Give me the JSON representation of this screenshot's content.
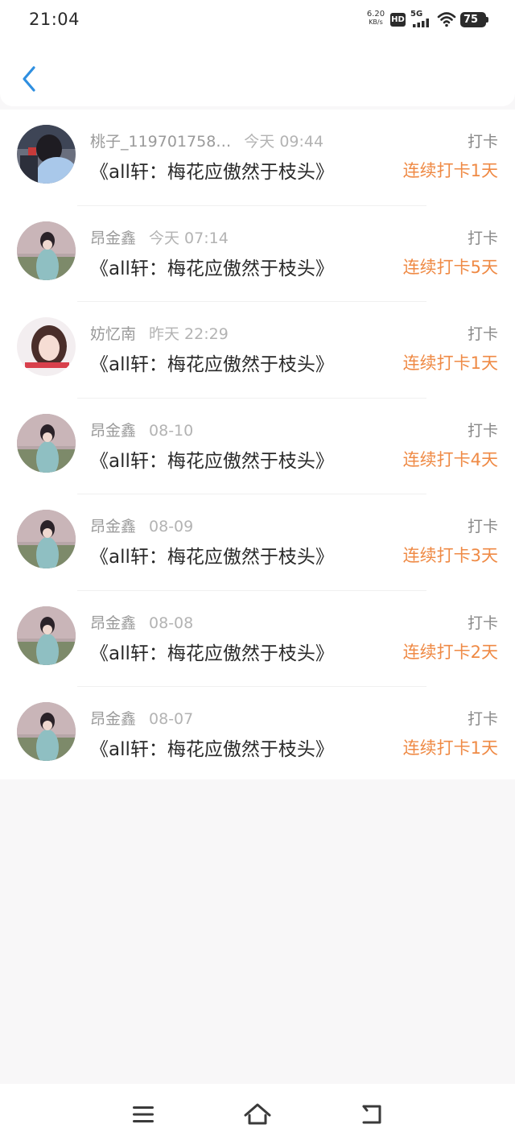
{
  "status_bar": {
    "time": "21:04",
    "net_speed_value": "6.20",
    "net_speed_unit": "KB/s",
    "hd": "HD",
    "network": "5G",
    "battery": "75"
  },
  "header": {
    "back_icon": "chevron-left-icon",
    "accent_color": "#2f8fe0"
  },
  "checkins": [
    {
      "user": "桃子_119701758…",
      "time": "今天 09:44",
      "title": "《all轩：梅花应傲然于枝头》",
      "type": "打卡",
      "streak": "连续打卡1天",
      "avatar": "avatar-photo-1"
    },
    {
      "user": "昂金鑫",
      "time": "今天 07:14",
      "title": "《all轩：梅花应傲然于枝头》",
      "type": "打卡",
      "streak": "连续打卡5天",
      "avatar": "avatar-photo-2"
    },
    {
      "user": "妨忆南",
      "time": "昨天 22:29",
      "title": "《all轩：梅花应傲然于枝头》",
      "type": "打卡",
      "streak": "连续打卡1天",
      "avatar": "avatar-photo-3"
    },
    {
      "user": "昂金鑫",
      "time": "08-10",
      "title": "《all轩：梅花应傲然于枝头》",
      "type": "打卡",
      "streak": "连续打卡4天",
      "avatar": "avatar-photo-2"
    },
    {
      "user": "昂金鑫",
      "time": "08-09",
      "title": "《all轩：梅花应傲然于枝头》",
      "type": "打卡",
      "streak": "连续打卡3天",
      "avatar": "avatar-photo-2"
    },
    {
      "user": "昂金鑫",
      "time": "08-08",
      "title": "《all轩：梅花应傲然于枝头》",
      "type": "打卡",
      "streak": "连续打卡2天",
      "avatar": "avatar-photo-2"
    },
    {
      "user": "昂金鑫",
      "time": "08-07",
      "title": "《all轩：梅花应傲然于枝头》",
      "type": "打卡",
      "streak": "连续打卡1天",
      "avatar": "avatar-photo-2"
    }
  ],
  "colors": {
    "streak": "#ef8a45",
    "background": "#f8f7f8"
  },
  "nav_bar": {
    "icons": [
      "menu-icon",
      "home-icon",
      "back-icon"
    ]
  }
}
